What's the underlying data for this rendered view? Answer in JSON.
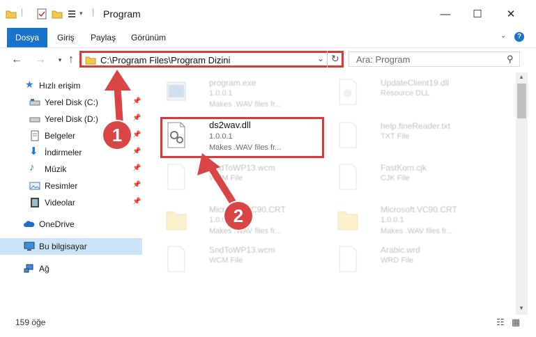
{
  "window": {
    "title": "Program"
  },
  "ribbon": {
    "tabs": [
      "Dosya",
      "Giriş",
      "Paylaş",
      "Görünüm"
    ]
  },
  "address": {
    "path": "C:\\Program Files\\Program Dizini"
  },
  "search": {
    "placeholder": "Ara: Program"
  },
  "sidebar": {
    "items": [
      {
        "label": "Hızlı erişim",
        "icon": "star-icon"
      },
      {
        "label": "Yerel Disk (C:)",
        "icon": "drive-icon"
      },
      {
        "label": "Yerel Disk (D:)",
        "icon": "drive-icon"
      },
      {
        "label": "Belgeler",
        "icon": "documents-icon"
      },
      {
        "label": "İndirmeler",
        "icon": "download-icon"
      },
      {
        "label": "Müzik",
        "icon": "music-icon"
      },
      {
        "label": "Resimler",
        "icon": "pictures-icon"
      },
      {
        "label": "Videolar",
        "icon": "video-icon"
      },
      {
        "label": "OneDrive",
        "icon": "cloud-icon"
      },
      {
        "label": "Bu bilgisayar",
        "icon": "computer-icon"
      },
      {
        "label": "Ağ",
        "icon": "network-icon"
      }
    ]
  },
  "files": [
    {
      "name": "program.exe",
      "line2": "1.0.0.1",
      "line3": "Makes .WAV files fr..."
    },
    {
      "name": "UpdateClient19.dll",
      "line2": "Resource DLL",
      "line3": ""
    },
    {
      "name": "ds2wav.dll",
      "line2": "1.0.0.1",
      "line3": "Makes .WAV files fr..."
    },
    {
      "name": "help.fineReader.txt",
      "line2": "TXT File",
      "line3": ""
    },
    {
      "name": "SndToWP13.wcm",
      "line2": "WCM File",
      "line3": ""
    },
    {
      "name": "FastKom.cjk",
      "line2": "CJK File",
      "line3": ""
    },
    {
      "name": "Microsoft.VC90.CRT",
      "line2": "1.0.0.1",
      "line3": "Makes .WAV files fr..."
    },
    {
      "name": "Microsoft.VC90.CRT",
      "line2": "1.0.0.1",
      "line3": "Makes .WAV files fr..."
    },
    {
      "name": "SndToWP13.wcm",
      "line2": "WCM File",
      "line3": ""
    },
    {
      "name": "Arabic.wrd",
      "line2": "WRD File",
      "line3": ""
    }
  ],
  "status": {
    "count": "159 öğe"
  },
  "annotations": {
    "step1": "1",
    "step2": "2"
  },
  "colors": {
    "accent": "#1a73c8",
    "highlight": "#d63a3a",
    "selected": "#cce4f7"
  }
}
